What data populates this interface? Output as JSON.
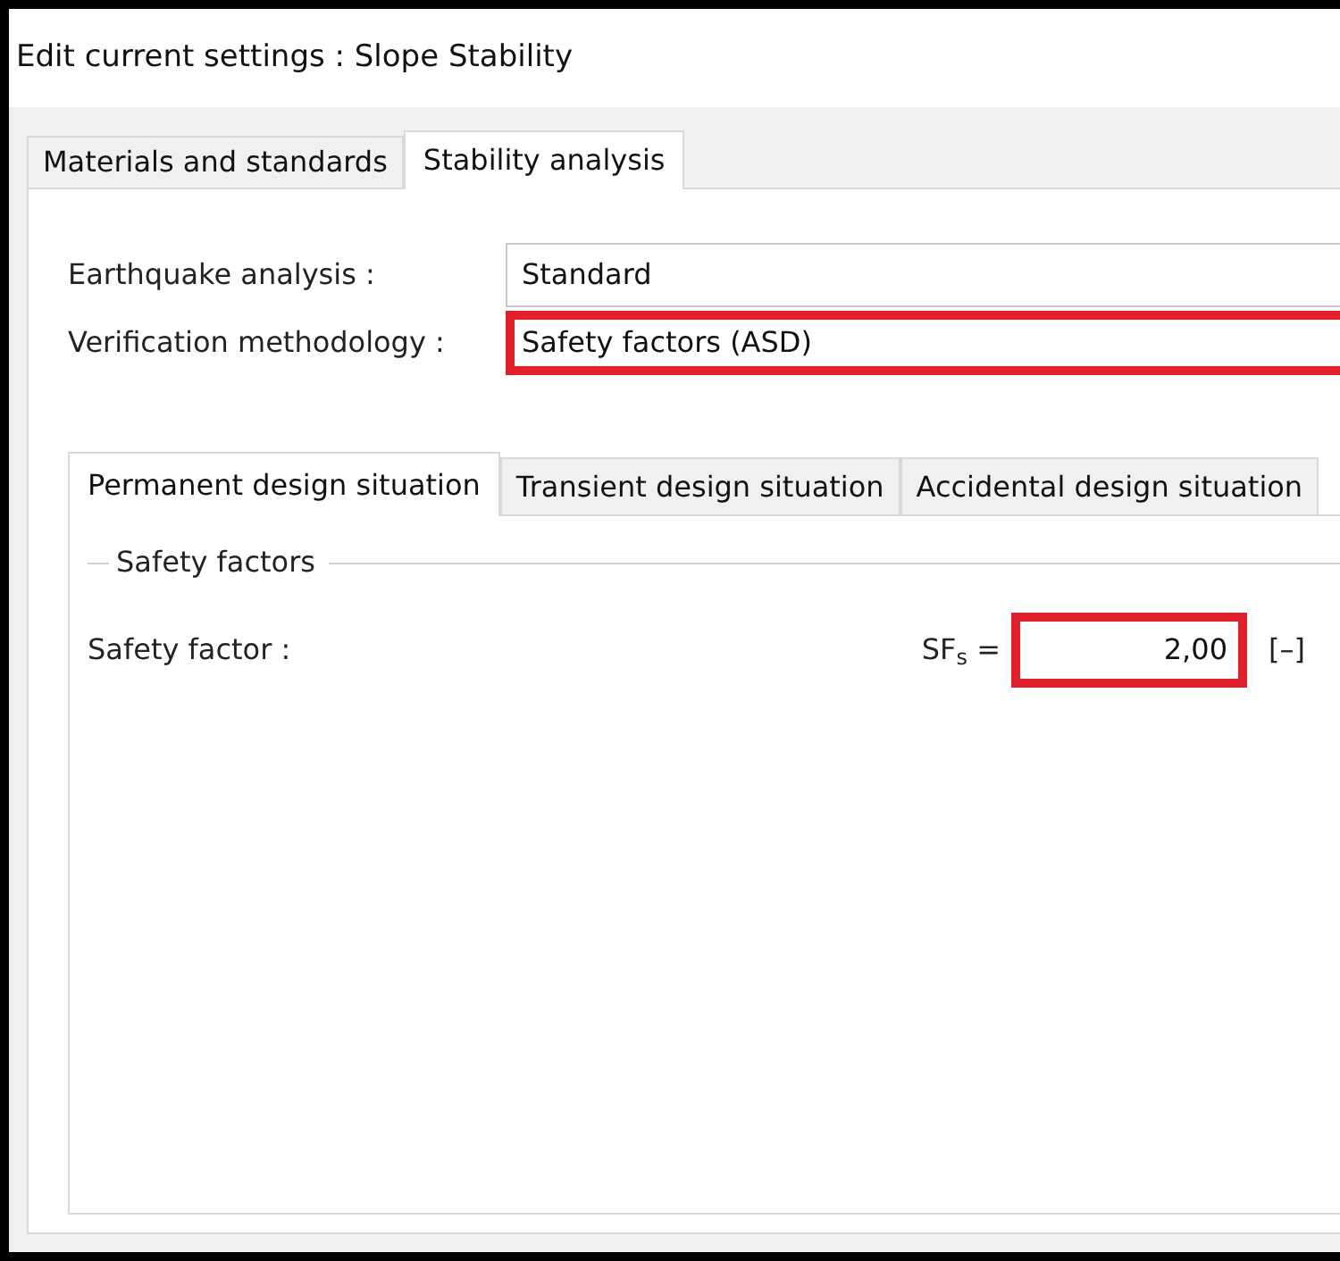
{
  "window": {
    "title": "Edit current settings : Slope Stability"
  },
  "tabs": [
    {
      "label": "Materials and standards",
      "selected": false
    },
    {
      "label": "Stability analysis",
      "selected": true
    }
  ],
  "fields": [
    {
      "label": "Earthquake analysis :",
      "value": "Standard",
      "highlighted": false
    },
    {
      "label": "Verification methodology :",
      "value": "Safety factors (ASD)",
      "highlighted": true
    }
  ],
  "design_tabs": [
    {
      "label": "Permanent design situation",
      "selected": true
    },
    {
      "label": "Transient design situation",
      "selected": false
    },
    {
      "label": "Accidental design situation",
      "selected": false
    }
  ],
  "group": {
    "title": "Safety factors",
    "rows": [
      {
        "label": "Safety factor :",
        "symbol": "SF$_{s}$ =",
        "value": "2,00",
        "unit": "[–]",
        "highlighted": true
      }
    ]
  }
}
